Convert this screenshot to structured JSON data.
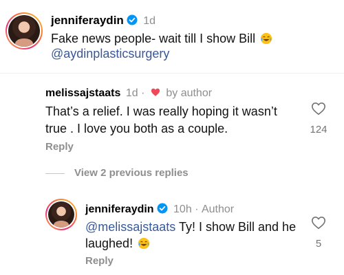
{
  "post": {
    "author": "jenniferaydin",
    "time": "1d",
    "caption": "Fake news people- wait till I show Bill",
    "caption_emoji": "laughing-tears",
    "mention": "@aydinplasticsurgery"
  },
  "comment": {
    "author": "melissajstaats",
    "time": "1d",
    "liked_by": "by author",
    "line1": "That’s a relief. I was really hoping it wasn’t",
    "line2": "true . I love you both as a couple.",
    "likes": "124",
    "reply_label": "Reply"
  },
  "view_replies": "View 2 previous replies",
  "reply": {
    "author": "jenniferaydin",
    "time": "10h",
    "badge": "Author",
    "separator": "·",
    "mention": "@melissajstaats",
    "text1": " Ty! I show Bill and he",
    "text2": "laughed!",
    "likes": "5",
    "reply_label": "Reply"
  },
  "colors": {
    "link": "#385898",
    "muted": "#8e8e8e",
    "verified": "#0095f6",
    "heart": "#ed4956"
  }
}
